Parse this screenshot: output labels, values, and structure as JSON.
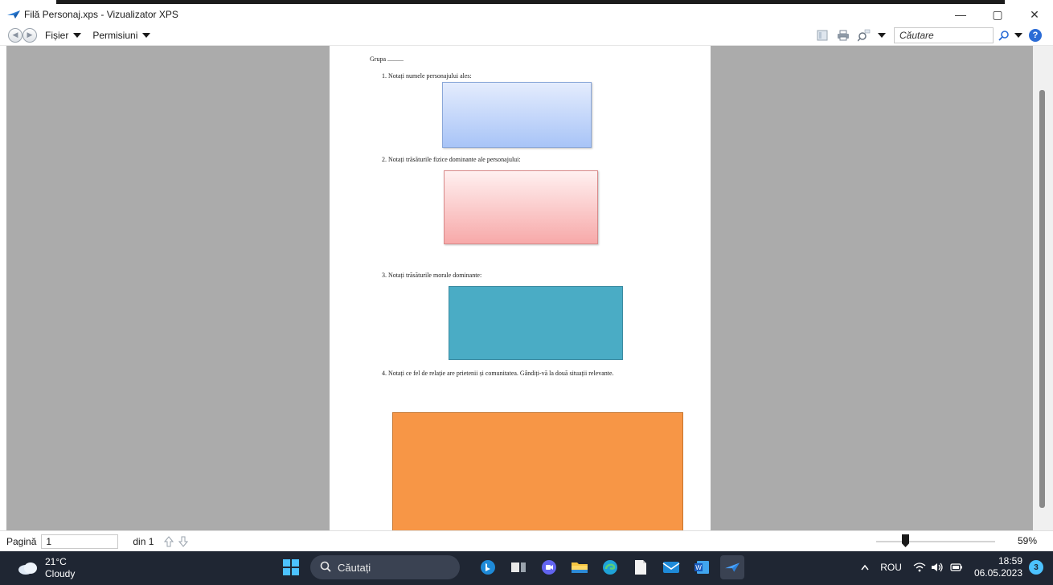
{
  "window": {
    "title": "Filă Personaj.xps - Vizualizator XPS",
    "minimize": "—",
    "maximize": "▢",
    "close": "✕"
  },
  "menu": {
    "file_label": "Fișier",
    "permissions_label": "Permisiuni",
    "search_placeholder": "Căutare"
  },
  "document": {
    "group_label": "Grupa ..........",
    "items": [
      "1.   Notați numele personajului ales:",
      "2.   Notați trăsăturile fizice dominante ale personajului:",
      "3.   Notați trăsăturile morale dominante:",
      "4.   Notați ce fel de relație are prietenii și comunitatea. Gândiți-vă la două situații relevante."
    ],
    "box_colors": {
      "blue": "#a8c4f7",
      "pink": "#f7a9a9",
      "teal": "#4aacc5",
      "orange": "#f79646"
    }
  },
  "status": {
    "page_label": "Pagină",
    "page_value": "1",
    "page_total": "din 1",
    "zoom": "59%"
  },
  "taskbar": {
    "temperature": "21°C",
    "weather": "Cloudy",
    "search_label": "Căutați",
    "language": "ROU",
    "time": "18:59",
    "date": "06.05.2023",
    "notification_count": "3"
  }
}
